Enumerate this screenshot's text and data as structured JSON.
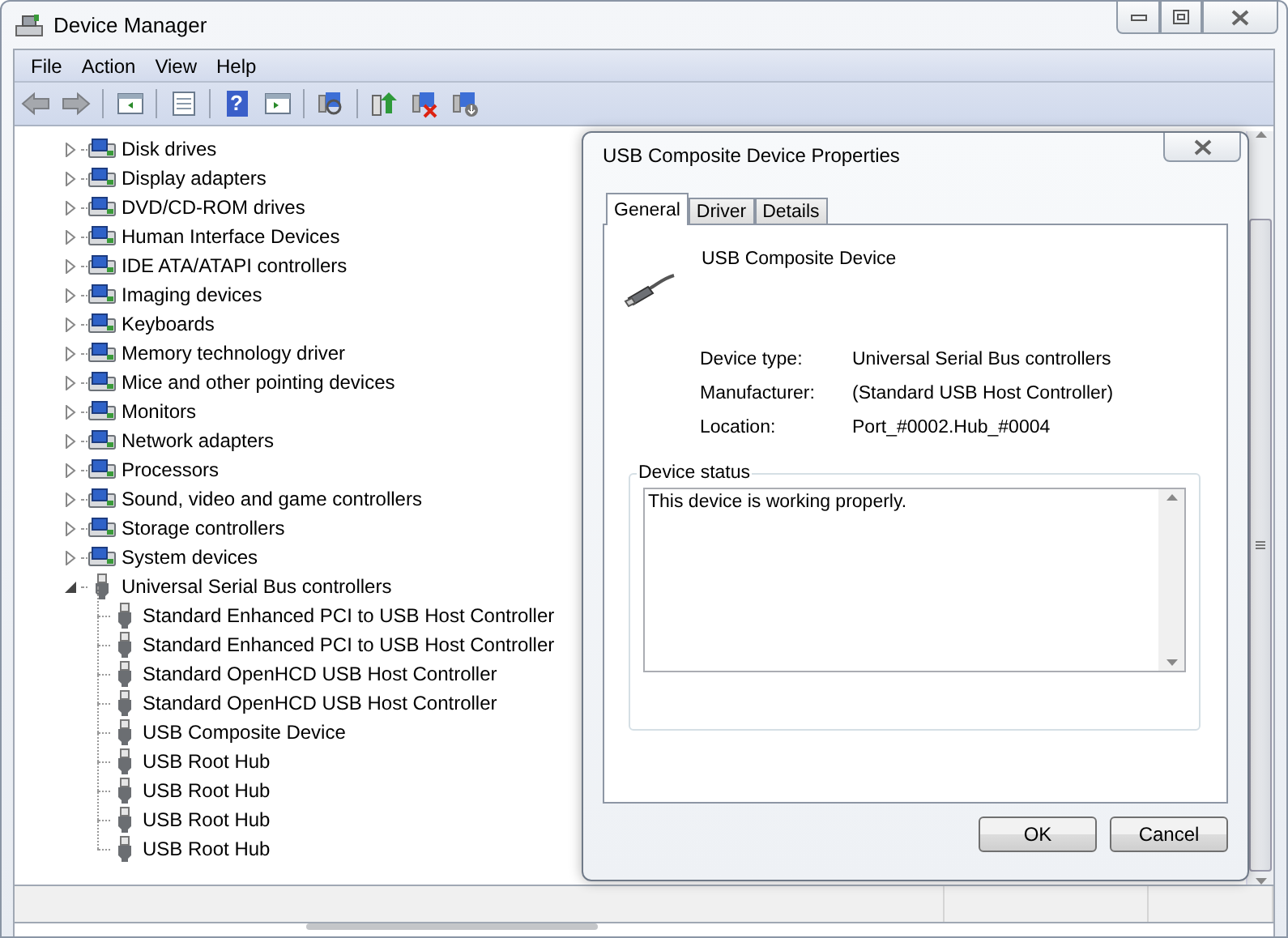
{
  "window": {
    "title": "Device Manager"
  },
  "menu": [
    "File",
    "Action",
    "View",
    "Help"
  ],
  "toolbar": {
    "help_glyph": "?"
  },
  "tree": [
    {
      "label": "Disk drives",
      "expanded": false
    },
    {
      "label": "Display adapters",
      "expanded": false
    },
    {
      "label": "DVD/CD-ROM drives",
      "expanded": false
    },
    {
      "label": "Human Interface Devices",
      "expanded": false
    },
    {
      "label": "IDE ATA/ATAPI controllers",
      "expanded": false
    },
    {
      "label": "Imaging devices",
      "expanded": false
    },
    {
      "label": "Keyboards",
      "expanded": false
    },
    {
      "label": "Memory technology driver",
      "expanded": false
    },
    {
      "label": "Mice and other pointing devices",
      "expanded": false
    },
    {
      "label": "Monitors",
      "expanded": false
    },
    {
      "label": "Network adapters",
      "expanded": false
    },
    {
      "label": "Processors",
      "expanded": false
    },
    {
      "label": "Sound, video and game controllers",
      "expanded": false
    },
    {
      "label": "Storage controllers",
      "expanded": false
    },
    {
      "label": "System devices",
      "expanded": false
    },
    {
      "label": "Universal Serial Bus controllers",
      "expanded": true,
      "children": [
        {
          "label": "Standard Enhanced PCI to USB Host Controller"
        },
        {
          "label": "Standard Enhanced PCI to USB Host Controller"
        },
        {
          "label": "Standard OpenHCD USB Host Controller"
        },
        {
          "label": "Standard OpenHCD USB Host Controller"
        },
        {
          "label": "USB Composite Device"
        },
        {
          "label": "USB Root Hub"
        },
        {
          "label": "USB Root Hub"
        },
        {
          "label": "USB Root Hub"
        },
        {
          "label": "USB Root Hub"
        }
      ]
    }
  ],
  "dialog": {
    "title": "USB Composite Device Properties",
    "tabs": [
      {
        "label": "General",
        "selected": true
      },
      {
        "label": "Driver",
        "selected": false
      },
      {
        "label": "Details",
        "selected": false
      }
    ],
    "device_name": "USB Composite Device",
    "properties": [
      {
        "label": "Device type:",
        "value": "Universal Serial Bus controllers"
      },
      {
        "label": "Manufacturer:",
        "value": "(Standard USB Host Controller)"
      },
      {
        "label": "Location:",
        "value": "Port_#0002.Hub_#0004"
      }
    ],
    "status_group": "Device status",
    "status_text": "This device is working properly.",
    "buttons": [
      "OK",
      "Cancel"
    ]
  }
}
